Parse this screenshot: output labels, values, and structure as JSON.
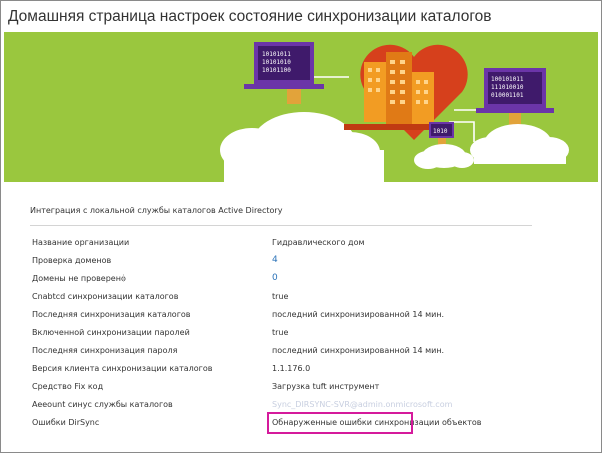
{
  "window": {
    "title": "Домашняя страница настроек состояние синхронизации каталогов"
  },
  "banner": {
    "laptop_left_text": [
      "10101011",
      "10101010",
      "10101100"
    ],
    "laptop_right_text": [
      "100101011",
      "111010010",
      "010001101"
    ],
    "small_device_text": "1010",
    "colors": {
      "background": "#9ac73e",
      "heart": "#d6401c",
      "building": "#f29c23",
      "cloud": "#ffffff",
      "screen": "#6b35a8"
    }
  },
  "section": {
    "heading": "Интеграция с локальной службы каталогов Active Directory"
  },
  "rows": [
    {
      "label": "Название организации",
      "value": "Гидравлического дом"
    },
    {
      "label": "Проверка доменов",
      "value": "4"
    },
    {
      "label": "Домены не проверено",
      "value": "0"
    },
    {
      "label": "Cnabtcd синхронизации каталогов",
      "value": "true"
    },
    {
      "label": "Последняя синхронизация каталогов",
      "value": "последний синхронизированной 14 мин."
    },
    {
      "label": "Включенной синхронизации паролей",
      "value": "true"
    },
    {
      "label": "Последняя синхронизация пароля",
      "value": "последний синхронизированной 14 мин."
    },
    {
      "label": "Версия клиента синхронизации каталогов",
      "value": "1.1.176.0"
    },
    {
      "label": "Средство Fix код",
      "value": "Загрузка tuft инструмент"
    },
    {
      "label": "Aeeount синус службы каталогов",
      "value": "Sync_DIRSYNC-SVR@admin.onmicrosoft.com"
    },
    {
      "label": "Ошибки DirSync",
      "value": "Обнаруженные ошибки синхронизации объектов"
    }
  ],
  "colors": {
    "link": "#2a72b8",
    "highlight_border": "#d51a9c"
  }
}
